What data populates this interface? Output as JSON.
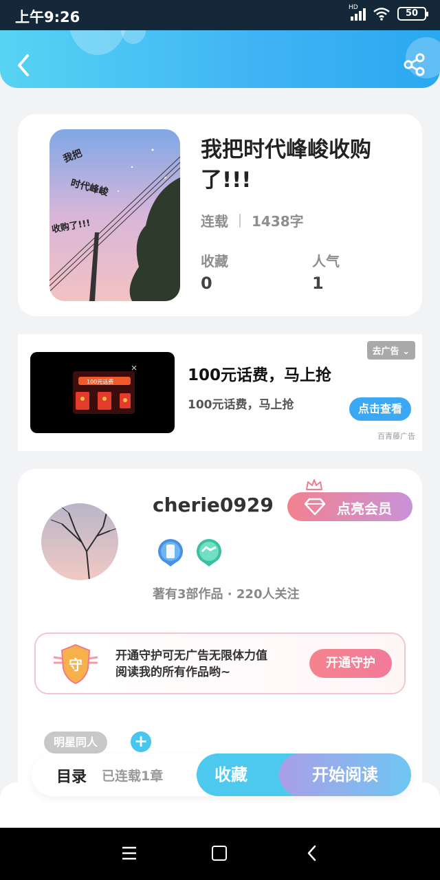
{
  "status_bar": {
    "time": "上午9:26",
    "network": "HD",
    "battery": "50"
  },
  "book": {
    "title": "我把时代峰峻收购了!!!",
    "status": "连载",
    "word_count": "1438字",
    "favorites_label": "收藏",
    "favorites_value": "0",
    "popularity_label": "人气",
    "popularity_value": "1",
    "cover_text": [
      "我把",
      "时代峰峻",
      "收购了!!!"
    ]
  },
  "ad": {
    "title": "100元话费，马上抢",
    "subtitle": "100元话费，马上抢",
    "remove_label": "去广告",
    "button_label": "点击查看",
    "source": "百青藤广告",
    "image_text": "100元话费"
  },
  "author": {
    "username": "cherie0929",
    "vip_label": "点亮会员",
    "works_info": "著有3部作品 · 220人关注",
    "guard_text_line1": "开通守护可无广告无限体力值",
    "guard_text_line2": "阅读我的所有作品哟~",
    "guard_button": "开通守护",
    "guard_icon_char": "守",
    "tag": "明星同人",
    "tag_add": "+"
  },
  "action_bar": {
    "toc_label": "目录",
    "chapters": "已连载1章",
    "favorite_button": "收藏",
    "read_button": "开始阅读"
  },
  "colors": {
    "accent": "#3fb3f4",
    "vip": "#f2818f",
    "guard": "#f27a9a"
  }
}
